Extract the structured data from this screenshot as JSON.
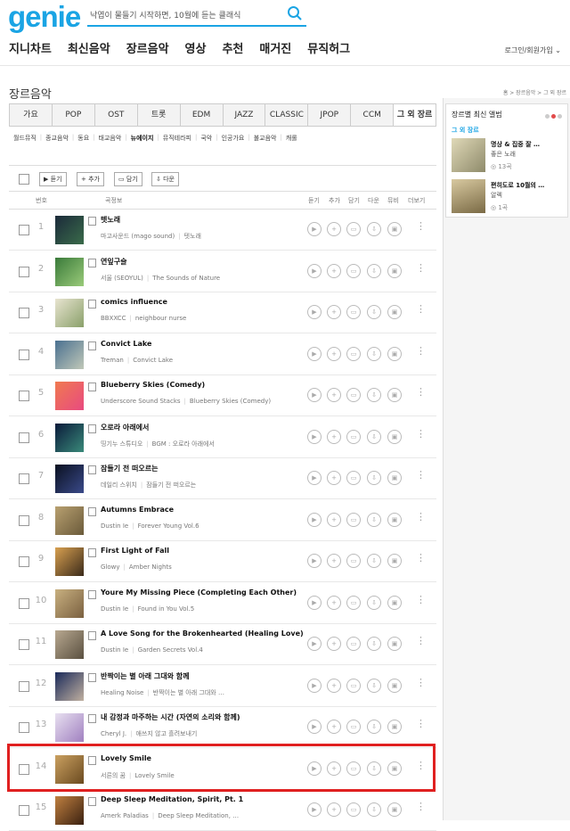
{
  "header": {
    "logo": "genie",
    "search_value": "낙엽이 물들기 시작하면, 10월에 듣는 클래식",
    "login": "로그인/회원가입"
  },
  "gnb": [
    "지니차트",
    "최신음악",
    "장르음악",
    "영상",
    "추천",
    "매거진",
    "뮤직허그"
  ],
  "page": {
    "title": "장르음악",
    "breadcrumb": "홈 > 장르음악 > 그 외 장르"
  },
  "genre_tabs": [
    "가요",
    "POP",
    "OST",
    "트롯",
    "EDM",
    "JAZZ",
    "CLASSIC",
    "JPOP",
    "CCM",
    "그 외 장르"
  ],
  "subnav": [
    "월드뮤직",
    "종교음악",
    "동요",
    "태교음악",
    "뉴에이지",
    "뮤직테라피",
    "국악",
    "인공가요",
    "불교음악",
    "캐롤"
  ],
  "toolbar": {
    "play": "듣기",
    "add": "추가",
    "put": "담기",
    "down": "다운"
  },
  "columns": {
    "num": "번호",
    "info": "곡정보",
    "play": "듣기",
    "add": "추가",
    "put": "담기",
    "down": "다운",
    "mv": "뮤비",
    "more": "더보기"
  },
  "songs": [
    {
      "num": "1",
      "title": "텟노래",
      "artist": "마고사운드 (mago sound)",
      "album": "텟노래"
    },
    {
      "num": "2",
      "title": "연잎구슬",
      "artist": "서울 (SEOYUL)",
      "album": "The Sounds of Nature"
    },
    {
      "num": "3",
      "title": "comics influence",
      "artist": "BBXXCC",
      "album": "neighbour nurse"
    },
    {
      "num": "4",
      "title": "Convict Lake",
      "artist": "Treman",
      "album": "Convict Lake"
    },
    {
      "num": "5",
      "title": "Blueberry Skies (Comedy)",
      "artist": "Underscore Sound Stacks",
      "album": "Blueberry Skies (Comedy)"
    },
    {
      "num": "6",
      "title": "오로라 아래에서",
      "artist": "띵기누 스튜디오",
      "album": "BGM : 오로라 아래에서"
    },
    {
      "num": "7",
      "title": "잠들기 전 떠오르는",
      "artist": "데일리 스위치",
      "album": "잠들기 전 떠오르는"
    },
    {
      "num": "8",
      "title": "Autumns Embrace",
      "artist": "Dustin Ie",
      "album": "Forever Young Vol.6"
    },
    {
      "num": "9",
      "title": "First Light of Fall",
      "artist": "Glowy",
      "album": "Amber Nights"
    },
    {
      "num": "10",
      "title": "Youre My Missing Piece (Completing Each Other)",
      "artist": "Dustin Ie",
      "album": "Found in You Vol.5"
    },
    {
      "num": "11",
      "title": "A Love Song for the Brokenhearted (Healing Love)",
      "artist": "Dustin Ie",
      "album": "Garden Secrets Vol.4"
    },
    {
      "num": "12",
      "title": "반짝이는 별 아래 그대와 함께",
      "artist": "Healing Noise",
      "album": "반짝이는 별 아래 그대와 …"
    },
    {
      "num": "13",
      "title": "내 감정과 마주하는 시간 (자연의 소리와 함께)",
      "artist": "Cheryl J.",
      "album": "애쓰지 않고 흘려보내기"
    },
    {
      "num": "14",
      "title": "Lovely Smile",
      "artist": "서른의 꿈",
      "album": "Lovely Smile"
    },
    {
      "num": "15",
      "title": "Deep Sleep Meditation, Spirit, Pt. 1",
      "artist": "Amerk Paladias",
      "album": "Deep Sleep Meditation, …"
    }
  ],
  "side": {
    "title": "장르별 최신 앨범",
    "genre": "그 외 장르",
    "albums": [
      {
        "title": "명상 & 집중 잘 …",
        "artist": "좋은 노래",
        "count": "13곡"
      },
      {
        "title": "편히도로 10월의 …",
        "artist": "알렉",
        "count": "1곡"
      }
    ]
  }
}
